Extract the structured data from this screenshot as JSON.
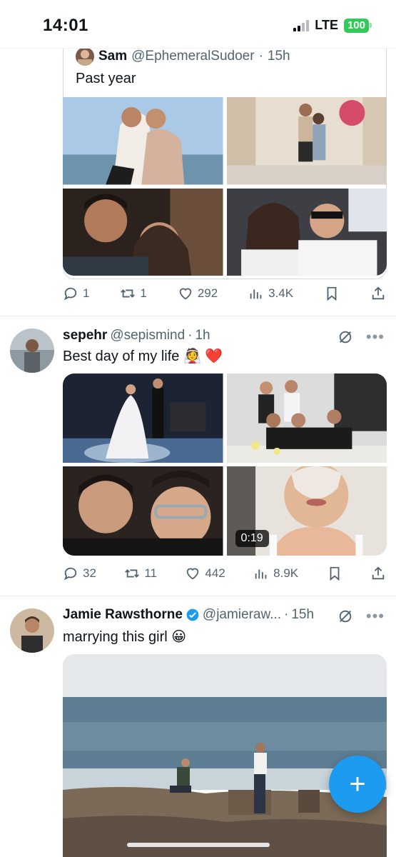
{
  "status_bar": {
    "time": "14:01",
    "network": "LTE",
    "battery": "100"
  },
  "quoted_tweet": {
    "name": "Sam",
    "handle": "@EphemeralSudoer",
    "time": "15h",
    "text": "Past year",
    "stats": {
      "replies": "1",
      "reposts": "1",
      "likes": "292",
      "views": "3.4K"
    }
  },
  "tweet_2": {
    "name": "sepehr",
    "handle": "@sepismind",
    "time": "1h",
    "text": "Best day of my life 👰 ❤️",
    "video_duration": "0:19",
    "stats": {
      "replies": "32",
      "reposts": "11",
      "likes": "442",
      "views": "8.9K"
    }
  },
  "tweet_3": {
    "name": "Jamie Rawsthorne",
    "handle": "@jamieraw...",
    "time": "15h",
    "text": "marrying this girl 😀"
  },
  "fab": {
    "label": "+"
  },
  "separator": "·",
  "colors": {
    "accent": "#1d9bf0",
    "secondary_text": "#536471",
    "battery": "#34c759"
  },
  "icons": [
    "reply-icon",
    "repost-icon",
    "like-icon",
    "views-icon",
    "bookmark-icon",
    "share-icon",
    "grok-icon",
    "more-icon",
    "verified-icon",
    "compose-icon"
  ]
}
